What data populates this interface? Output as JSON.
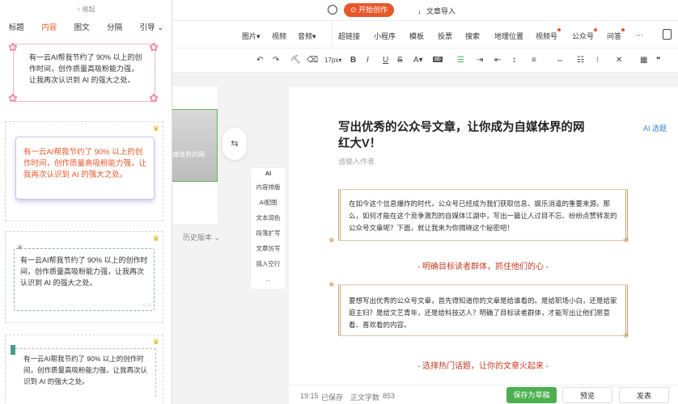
{
  "panel": {
    "collapse_label": "收起",
    "tabs": [
      "标题",
      "内容",
      "图文",
      "分隔",
      "引导"
    ],
    "card_text": "有一云AI帮我节约了 90% 以上的创作时间，创作质量高吸粉能力强，让我再次认识到 AI 的强大之处。",
    "history_label": "历史版本"
  },
  "preview": {
    "snippet": "媒体界的网"
  },
  "topbar": {
    "start_label": "开始创作",
    "import_label": "文章导入"
  },
  "toolbar1": [
    "图片",
    "视频",
    "音频",
    "超链接",
    "小程序",
    "模板",
    "投票",
    "搜索",
    "地理位置",
    "视频号",
    "公众号",
    "问答",
    "···"
  ],
  "toolbar2": {
    "font_size": "17px"
  },
  "side_menu": [
    "AI",
    "内容排版",
    "AI配图",
    "文本润色",
    "段落扩写",
    "文章仿写",
    "插入空行",
    "..."
  ],
  "editor": {
    "title": "写出优秀的公众号文章，让你成为自媒体界的网红大V！",
    "ai_topic": "AI 选题",
    "author_placeholder": "请输入作者",
    "para1": "在如今这个信息爆炸的时代，公众号已经成为我们获取信息、娱乐消遣的重要来源。那么，如何才能在这个竞争激烈的自媒体江湖中，写出一篇让人过目不忘、纷纷点赞转发的公众号文章呢？下面，就让我来为你揭晓这个秘密吧！",
    "heading1": "明确目标读者群体，抓住他们的心",
    "para2": "要想写出优秀的公众号文章，首先得知道你的文章是给谁看的。是给职场小白，还是给家庭主妇？是给文艺青年，还是给科技达人？明确了目标读者群体，才能写出让他们愿意看、喜欢看的内容。",
    "heading2": "选择热门话题，让你的文章火起来"
  },
  "footer": {
    "time": "19:15",
    "saved": "已保存",
    "word_count_label": "正文字数",
    "word_count": "853",
    "save_draft": "保存为草稿",
    "preview": "预览",
    "publish": "发表"
  },
  "colors": {
    "accent": "#e8562a",
    "green": "#4caf50"
  }
}
